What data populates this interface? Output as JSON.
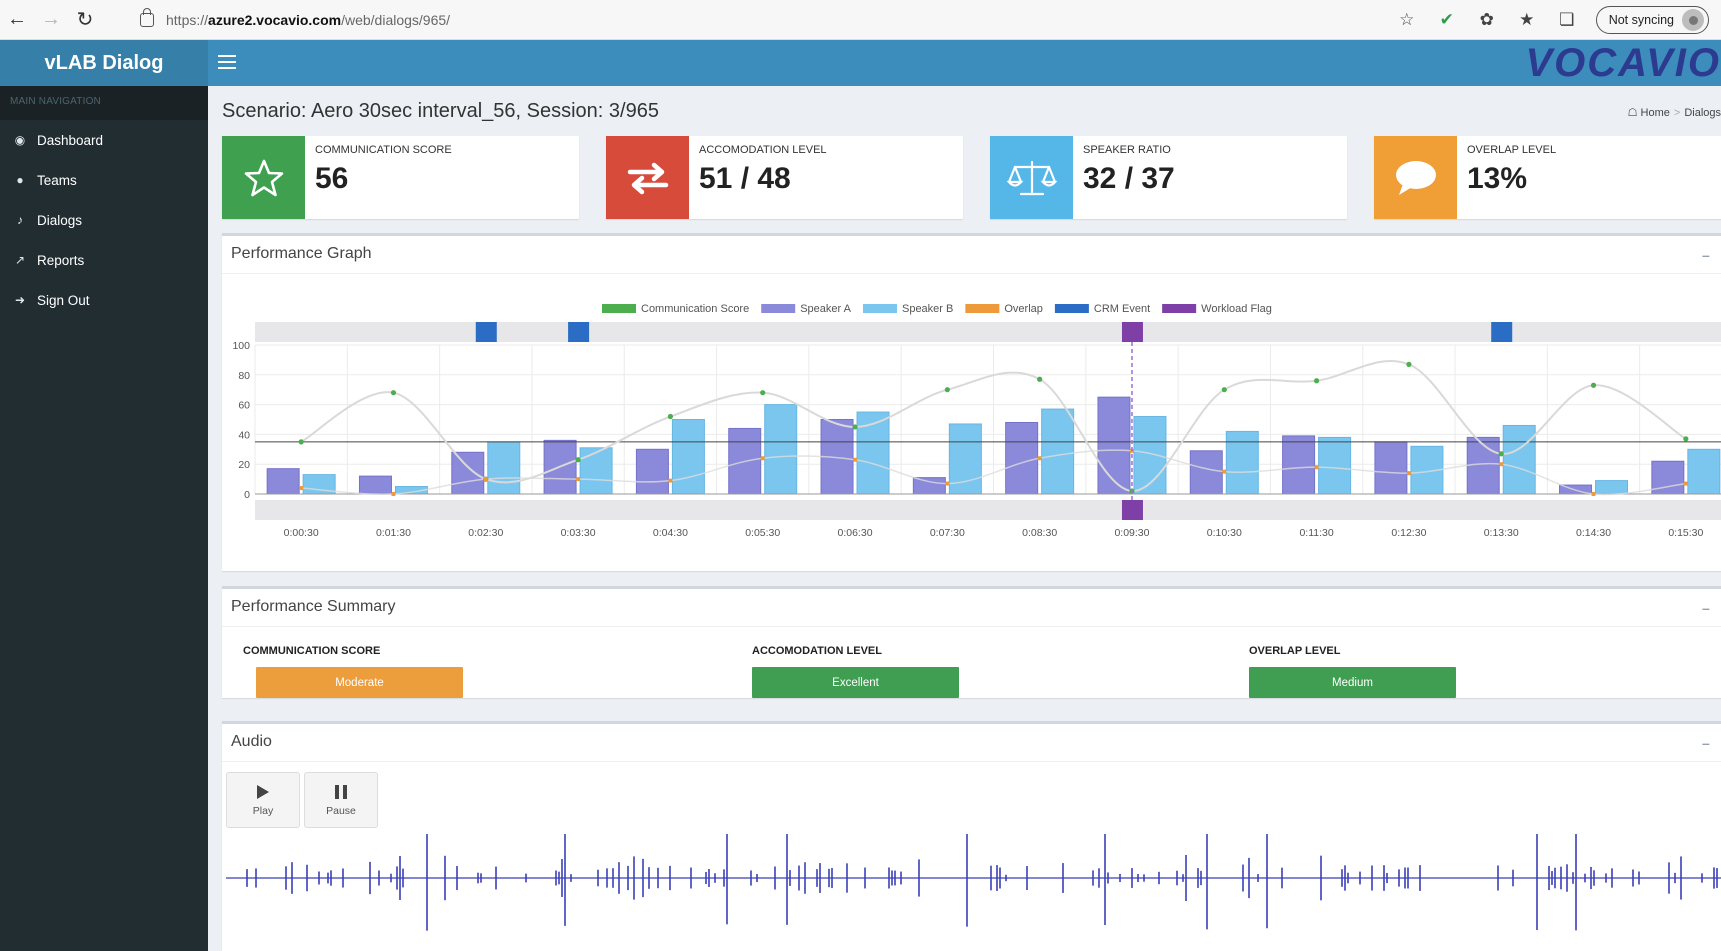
{
  "browser": {
    "url_scheme": "https://",
    "url_host": "azure2.vocavio.com",
    "url_path": "/web/dialogs/965/",
    "sync_label": "Not syncing"
  },
  "app": {
    "brand": "vLAB Dialog",
    "logo_text": "VOCAVIO",
    "nav_header": "MAIN NAVIGATION",
    "nav_items": [
      {
        "label": "Dashboard",
        "icon": "dashboard-icon"
      },
      {
        "label": "Teams",
        "icon": "user-icon"
      },
      {
        "label": "Dialogs",
        "icon": "microphone-icon"
      },
      {
        "label": "Reports",
        "icon": "line-chart-icon"
      },
      {
        "label": "Sign Out",
        "icon": "sign-out-icon"
      }
    ]
  },
  "page": {
    "title": "Scenario: Aero 30sec interval_56, Session: 3/965",
    "breadcrumb": [
      "Home",
      "Dialogs"
    ]
  },
  "info_boxes": [
    {
      "label": "COMMUNICATION SCORE",
      "value": "56",
      "color": "#3fa04f",
      "icon": "star-icon"
    },
    {
      "label": "ACCOMODATION LEVEL",
      "value": "51 / 48",
      "color": "#d74b3b",
      "icon": "exchange-icon"
    },
    {
      "label": "SPEAKER RATIO",
      "value": "32 / 37",
      "color": "#55b7e7",
      "icon": "balance-scale-icon"
    },
    {
      "label": "OVERLAP LEVEL",
      "value": "13%",
      "color": "#f09e36",
      "icon": "speech-bubble-icon"
    }
  ],
  "performance_graph": {
    "title": "Performance Graph",
    "minimize": "–",
    "close": "×"
  },
  "chart_data": {
    "type": "bar",
    "categories": [
      "0:00:30",
      "0:01:30",
      "0:02:30",
      "0:03:30",
      "0:04:30",
      "0:05:30",
      "0:06:30",
      "0:07:30",
      "0:08:30",
      "0:09:30",
      "0:10:30",
      "0:11:30",
      "0:12:30",
      "0:13:30",
      "0:14:30",
      "0:15:30"
    ],
    "ylim": [
      0,
      100
    ],
    "yticks": [
      0,
      20,
      40,
      60,
      80,
      100
    ],
    "series": [
      {
        "name": "Communication Score",
        "type": "line",
        "color": "#4cae4c",
        "values": [
          35,
          68,
          10,
          23,
          52,
          68,
          45,
          70,
          77,
          2,
          70,
          76,
          87,
          27,
          73,
          37
        ]
      },
      {
        "name": "Speaker A",
        "type": "bar",
        "color": "#8b89d9",
        "values": [
          17,
          12,
          28,
          36,
          30,
          44,
          50,
          11,
          48,
          65,
          29,
          39,
          35,
          38,
          6,
          22
        ]
      },
      {
        "name": "Speaker B",
        "type": "bar",
        "color": "#7ac6ef",
        "values": [
          13,
          5,
          35,
          31,
          50,
          60,
          55,
          47,
          57,
          52,
          42,
          38,
          32,
          46,
          9,
          30
        ]
      },
      {
        "name": "Overlap",
        "type": "line",
        "color": "#ee9a3a",
        "values": [
          4,
          0,
          10,
          10,
          9,
          24,
          23,
          7,
          24,
          29,
          15,
          18,
          14,
          20,
          0,
          7
        ]
      },
      {
        "name": "CRM Event",
        "type": "marker",
        "color": "#2b6cc4",
        "values": [
          "0:02:30",
          "0:03:30",
          "0:13:30"
        ]
      },
      {
        "name": "Workload Flag",
        "type": "marker",
        "color": "#7e3fa6",
        "values": [
          "0:09:30"
        ]
      }
    ],
    "threshold": 35,
    "grid": true,
    "legend": "top-center"
  },
  "summary": {
    "title": "Performance Summary",
    "items": [
      {
        "label": "COMMUNICATION SCORE",
        "status": "Moderate",
        "color": "#ec9d3c"
      },
      {
        "label": "ACCOMODATION LEVEL",
        "status": "Excellent",
        "color": "#3f9e52"
      },
      {
        "label": "OVERLAP LEVEL",
        "status": "Medium",
        "color": "#3f9e52"
      }
    ]
  },
  "audio": {
    "title": "Audio",
    "play_label": "Play",
    "pause_label": "Pause",
    "wave_color": "#3b3fb8"
  }
}
